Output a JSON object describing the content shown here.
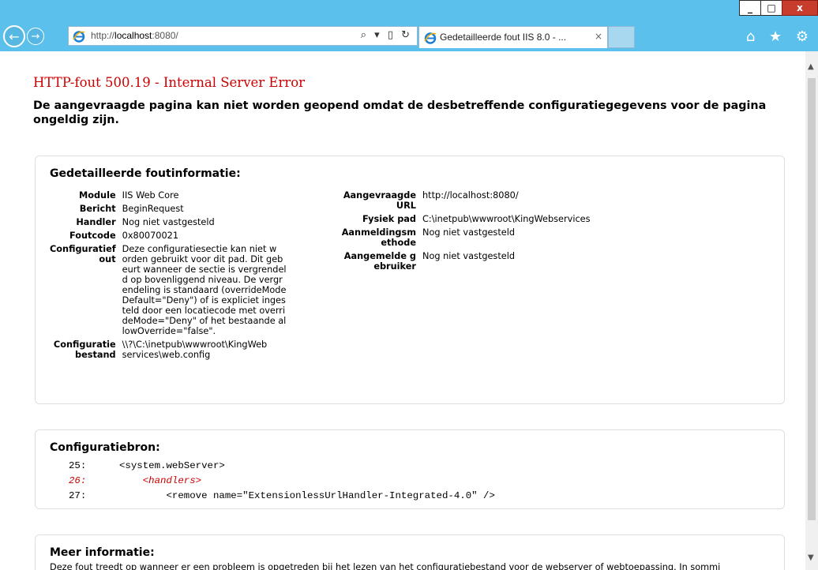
{
  "window": {
    "min_label": "_",
    "max_label": "□",
    "close_label": "x"
  },
  "nav": {
    "back_icon": "←",
    "forward_icon": "→",
    "address_prefix": "http://",
    "address_host": "localhost",
    "address_suffix": ":8080/",
    "address_tools": "⌕ ▾ ▯ ↻",
    "tab_title": "Gedetailleerde fout IIS 8.0 - ...",
    "tab_close": "×",
    "right_tools": "⌂ ★ ⚙"
  },
  "error": {
    "title": "HTTP-fout 500.19 - Internal Server Error",
    "subtitle": "De aangevraagde pagina kan niet worden geopend omdat de desbetreffende configuratiegegevens voor de pagina ongeldig zijn."
  },
  "details": {
    "heading": "Gedetailleerde foutinformatie:",
    "left": [
      {
        "label": "Module",
        "value": "IIS Web Core"
      },
      {
        "label": "Bericht",
        "value": "BeginRequest"
      },
      {
        "label": "Handler",
        "value": "Nog niet vastgesteld"
      },
      {
        "label": "Foutcode",
        "value": "0x80070021"
      },
      {
        "label": "Configuratief\nout",
        "value": "Deze configuratiesectie kan niet w\norden gebruikt voor dit pad. Dit geb\neurt wanneer de sectie is vergrendel\nd op bovenliggend niveau. De vergr\nendeling is standaard (overrideMode\nDefault=\"Deny\") of is expliciet inges\nteld door een locatiecode met overri\ndeMode=\"Deny\" of het bestaande al\nlowOverride=\"false\"."
      },
      {
        "label": "Configuratie\nbestand",
        "value": "\\\\?\\C:\\inetpub\\wwwroot\\KingWeb\nservices\\web.config"
      }
    ],
    "right": [
      {
        "label": "Aangevraagde\nURL",
        "value": "http://localhost:8080/"
      },
      {
        "label": "Fysiek pad",
        "value": "C:\\inetpub\\wwwroot\\KingWebservices"
      },
      {
        "label": "Aanmeldingsm\nethode",
        "value": "Nog niet vastgesteld"
      },
      {
        "label": "Aangemelde g\nebruiker",
        "value": "Nog niet vastgesteld"
      }
    ]
  },
  "source": {
    "heading": "Configuratiebron:",
    "lines": [
      {
        "num": "25:",
        "text": "<system.webServer>"
      },
      {
        "num": "26:",
        "text": "    <handlers>"
      },
      {
        "num": "27:",
        "text": "        <remove name=\"ExtensionlessUrlHandler-Integrated-4.0\" />"
      }
    ]
  },
  "more": {
    "heading": "Meer informatie:",
    "text": "Deze fout treedt op wanneer er een probleem is opgetreden bij het lezen van het configuratiebestand voor de webserver of webtoepassing. In sommi"
  }
}
